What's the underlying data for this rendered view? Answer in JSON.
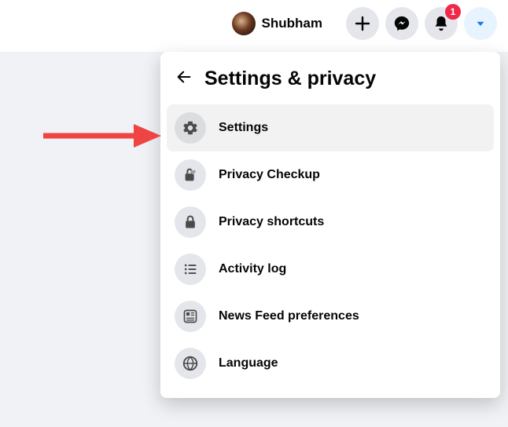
{
  "topbar": {
    "profile_name": "Shubham",
    "notification_badge": "1"
  },
  "dropdown": {
    "title": "Settings & privacy",
    "items": [
      {
        "label": "Settings",
        "icon": "gear-icon",
        "active": true
      },
      {
        "label": "Privacy Checkup",
        "icon": "lock-heart-icon",
        "active": false
      },
      {
        "label": "Privacy shortcuts",
        "icon": "lock-icon",
        "active": false
      },
      {
        "label": "Activity log",
        "icon": "list-icon",
        "active": false
      },
      {
        "label": "News Feed preferences",
        "icon": "feed-icon",
        "active": false
      },
      {
        "label": "Language",
        "icon": "globe-icon",
        "active": false
      }
    ]
  },
  "annotation": {
    "arrow_color": "#ef4444"
  }
}
